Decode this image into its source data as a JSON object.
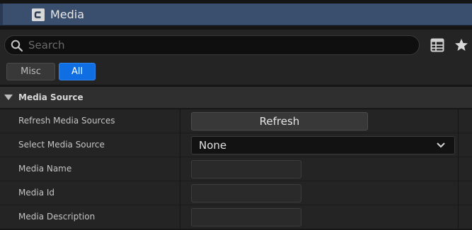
{
  "tab": {
    "title": "Media",
    "icon": "class-c-icon"
  },
  "search": {
    "placeholder": "Search",
    "value": ""
  },
  "toolbar": {
    "table_view_icon": "table-view-icon",
    "favorites_icon": "star-icon"
  },
  "filters": [
    {
      "label": "Misc",
      "active": false
    },
    {
      "label": "All",
      "active": true
    }
  ],
  "section": {
    "title": "Media Source",
    "expanded": true
  },
  "rows": [
    {
      "label": "Refresh Media Sources",
      "control": "button",
      "button_label": "Refresh"
    },
    {
      "label": "Select Media Source",
      "control": "select",
      "value": "None"
    },
    {
      "label": "Media Name",
      "control": "text",
      "value": ""
    },
    {
      "label": "Media Id",
      "control": "text",
      "value": ""
    },
    {
      "label": "Media Description",
      "control": "text",
      "value": ""
    }
  ],
  "colors": {
    "accent": "#0f6fe2",
    "tab_bg": "#3a4f6e",
    "panel_bg": "#242424"
  }
}
